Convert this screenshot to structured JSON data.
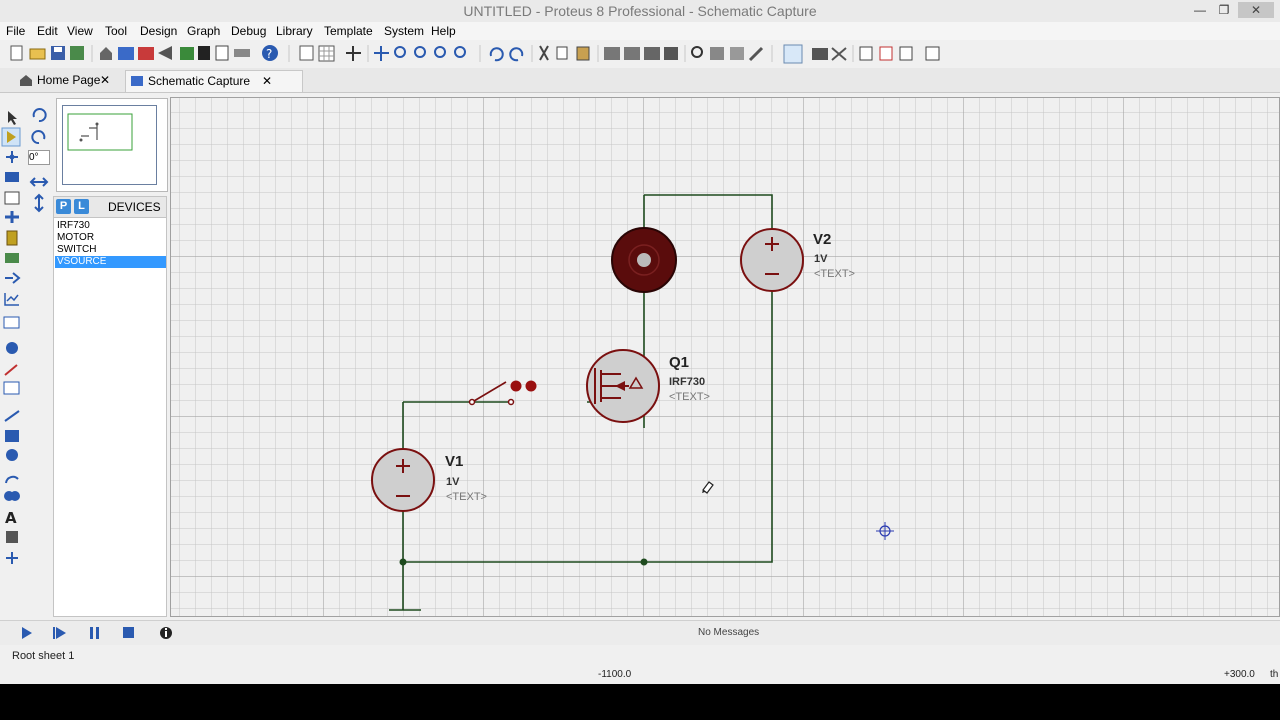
{
  "window": {
    "title": "UNTITLED - Proteus 8 Professional - Schematic Capture",
    "minimize": "—",
    "maximize": "❐",
    "close": "✕"
  },
  "menu": [
    "File",
    "Edit",
    "View",
    "Tool",
    "Design",
    "Graph",
    "Debug",
    "Library",
    "Template",
    "System",
    "Help"
  ],
  "tabs": [
    {
      "label": "Home Page",
      "close": "✕"
    },
    {
      "label": "Schematic Capture",
      "close": "✕"
    }
  ],
  "rotation_field": "0°",
  "devices_panel": {
    "p_label": "P",
    "l_label": "L",
    "title": "DEVICES",
    "items": [
      "IRF730",
      "MOTOR",
      "SWITCH",
      "VSOURCE"
    ],
    "selected": "VSOURCE"
  },
  "schematic": {
    "q1": {
      "ref": "Q1",
      "value": "IRF730",
      "text": "<TEXT>"
    },
    "v1": {
      "ref": "V1",
      "value": "1V",
      "text": "<TEXT>"
    },
    "v2": {
      "ref": "V2",
      "value": "1V",
      "text": "<TEXT>"
    }
  },
  "sim_controls": {
    "play": "play",
    "step": "step",
    "pause": "pause",
    "stop": "stop"
  },
  "status": {
    "messages": "No Messages",
    "sheet": "Root sheet 1",
    "coord_x": "-1100.0",
    "coord_y": "+300.0",
    "unit": "th"
  },
  "colors": {
    "wire": "#1e4a1e",
    "component": "#7a1010",
    "grid": "#c8c8c8",
    "canvas_bg": "#f0f0f0",
    "accent": "#3399ff"
  }
}
